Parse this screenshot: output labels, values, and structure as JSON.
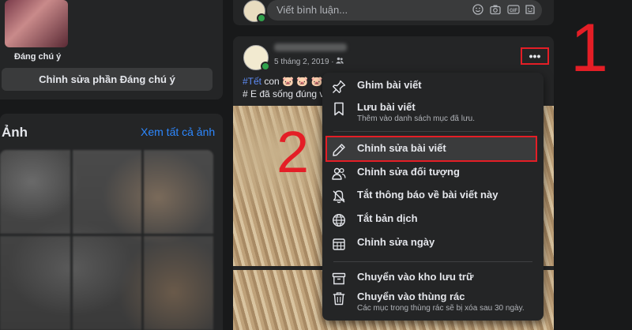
{
  "left": {
    "featured_label": "Đáng chú ý",
    "edit_featured_button": "Chỉnh sửa phần Đáng chú ý",
    "photos_title": "Ảnh",
    "see_all_photos": "Xem tất cả ảnh"
  },
  "comment": {
    "placeholder": "Viết bình luận...",
    "icons": [
      "smiley-icon",
      "camera-icon",
      "gif-icon",
      "sticker-icon"
    ]
  },
  "post": {
    "date": "5 tháng 2, 2019 · ",
    "audience_icon": "friends-icon",
    "more_button": "•••",
    "hashtag": "#Tết",
    "text_line1_rest": " con 🐷 🐷 🐷",
    "text_line2": "# E đã sống đúng v"
  },
  "annotations": {
    "step1": "1",
    "step2": "2",
    "color": "#e41e26"
  },
  "menu": {
    "items": [
      {
        "label": "Ghim bài viết",
        "icon": "pin-icon"
      },
      {
        "label": "Lưu bài viết",
        "sub": "Thêm vào danh sách mục đã lưu.",
        "icon": "bookmark-icon"
      },
      {
        "label": "Chỉnh sửa bài viết",
        "icon": "pencil-icon",
        "highlighted": true
      },
      {
        "label": "Chỉnh sửa đối tượng",
        "icon": "people-icon"
      },
      {
        "label": "Tắt thông báo về bài viết này",
        "icon": "bell-off-icon"
      },
      {
        "label": "Tắt bản dịch",
        "icon": "globe-icon"
      },
      {
        "label": "Chỉnh sửa ngày",
        "icon": "calendar-icon"
      },
      {
        "label": "Chuyển vào kho lưu trữ",
        "icon": "archive-icon"
      },
      {
        "label": "Chuyển vào thùng rác",
        "sub": "Các mục trong thùng rác sẽ bị xóa sau 30 ngày.",
        "icon": "trash-icon"
      }
    ]
  }
}
